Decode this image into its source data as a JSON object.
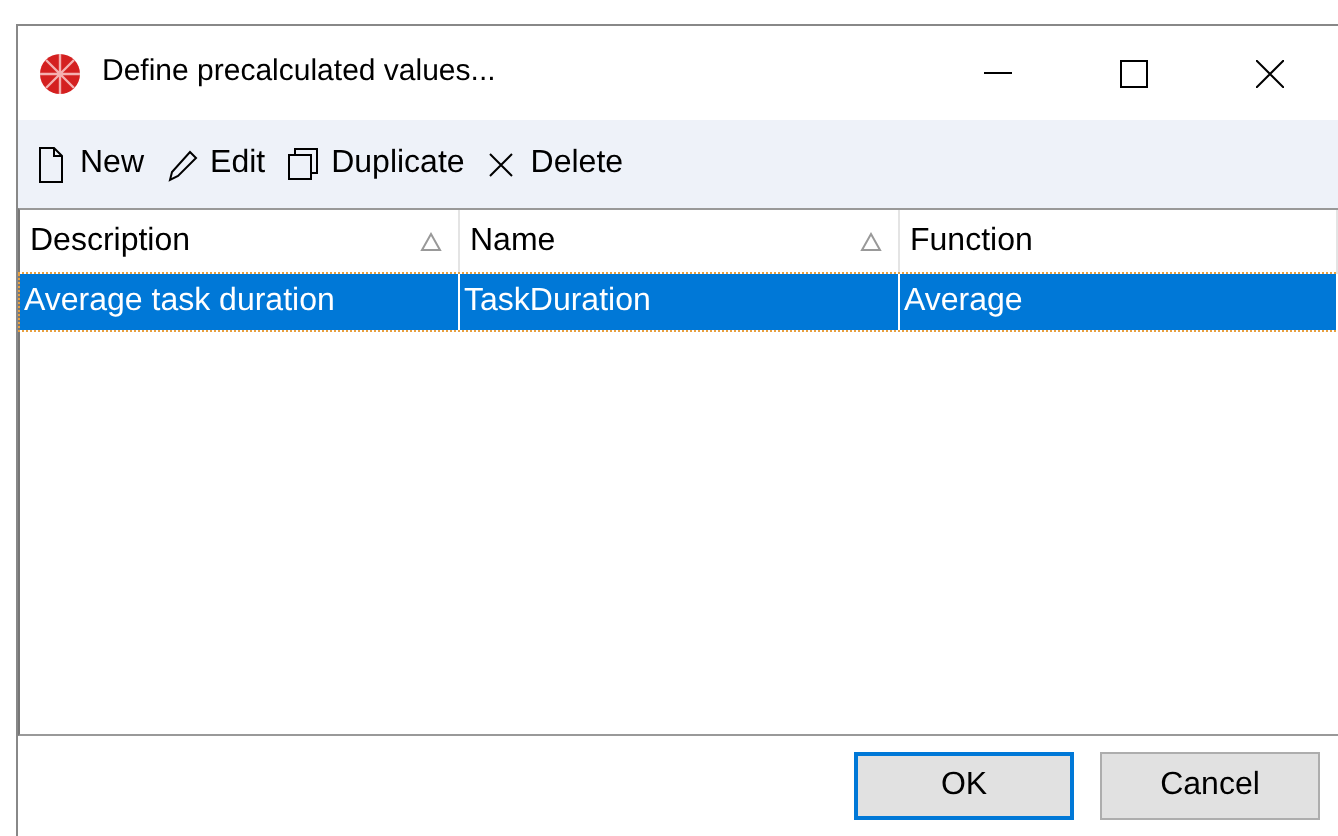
{
  "window": {
    "title": "Define precalculated values..."
  },
  "toolbar": [
    {
      "kind": "new",
      "label": "New"
    },
    {
      "kind": "edit",
      "label": "Edit"
    },
    {
      "kind": "duplicate",
      "label": "Duplicate"
    },
    {
      "kind": "delete",
      "label": "Delete"
    }
  ],
  "table": {
    "columns": [
      {
        "label": "Description",
        "sortable": true
      },
      {
        "label": "Name",
        "sortable": true
      },
      {
        "label": "Function",
        "sortable": false
      }
    ],
    "rows": [
      {
        "selected": true,
        "cells": [
          "Average task duration",
          "TaskDuration",
          "Average"
        ]
      }
    ]
  },
  "buttons": [
    {
      "label": "OK",
      "default": true
    },
    {
      "label": "Cancel",
      "default": false
    }
  ]
}
